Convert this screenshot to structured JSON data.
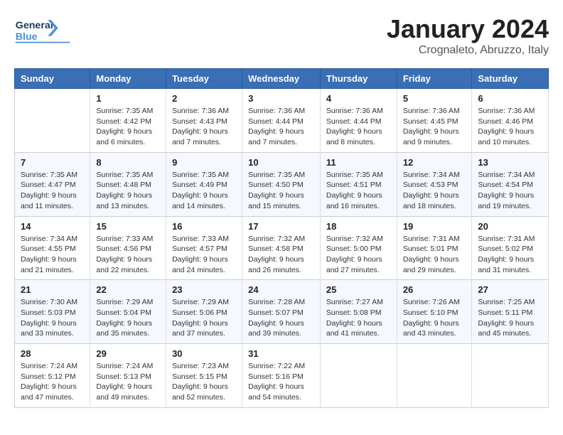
{
  "header": {
    "logo_line1": "General",
    "logo_line2": "Blue",
    "title": "January 2024",
    "subtitle": "Crognaleto, Abruzzo, Italy"
  },
  "columns": [
    "Sunday",
    "Monday",
    "Tuesday",
    "Wednesday",
    "Thursday",
    "Friday",
    "Saturday"
  ],
  "weeks": [
    [
      {
        "day": "",
        "info": ""
      },
      {
        "day": "1",
        "info": "Sunrise: 7:35 AM\nSunset: 4:42 PM\nDaylight: 9 hours\nand 6 minutes."
      },
      {
        "day": "2",
        "info": "Sunrise: 7:36 AM\nSunset: 4:43 PM\nDaylight: 9 hours\nand 7 minutes."
      },
      {
        "day": "3",
        "info": "Sunrise: 7:36 AM\nSunset: 4:44 PM\nDaylight: 9 hours\nand 7 minutes."
      },
      {
        "day": "4",
        "info": "Sunrise: 7:36 AM\nSunset: 4:44 PM\nDaylight: 9 hours\nand 8 minutes."
      },
      {
        "day": "5",
        "info": "Sunrise: 7:36 AM\nSunset: 4:45 PM\nDaylight: 9 hours\nand 9 minutes."
      },
      {
        "day": "6",
        "info": "Sunrise: 7:36 AM\nSunset: 4:46 PM\nDaylight: 9 hours\nand 10 minutes."
      }
    ],
    [
      {
        "day": "7",
        "info": "Sunrise: 7:35 AM\nSunset: 4:47 PM\nDaylight: 9 hours\nand 11 minutes."
      },
      {
        "day": "8",
        "info": "Sunrise: 7:35 AM\nSunset: 4:48 PM\nDaylight: 9 hours\nand 13 minutes."
      },
      {
        "day": "9",
        "info": "Sunrise: 7:35 AM\nSunset: 4:49 PM\nDaylight: 9 hours\nand 14 minutes."
      },
      {
        "day": "10",
        "info": "Sunrise: 7:35 AM\nSunset: 4:50 PM\nDaylight: 9 hours\nand 15 minutes."
      },
      {
        "day": "11",
        "info": "Sunrise: 7:35 AM\nSunset: 4:51 PM\nDaylight: 9 hours\nand 16 minutes."
      },
      {
        "day": "12",
        "info": "Sunrise: 7:34 AM\nSunset: 4:53 PM\nDaylight: 9 hours\nand 18 minutes."
      },
      {
        "day": "13",
        "info": "Sunrise: 7:34 AM\nSunset: 4:54 PM\nDaylight: 9 hours\nand 19 minutes."
      }
    ],
    [
      {
        "day": "14",
        "info": "Sunrise: 7:34 AM\nSunset: 4:55 PM\nDaylight: 9 hours\nand 21 minutes."
      },
      {
        "day": "15",
        "info": "Sunrise: 7:33 AM\nSunset: 4:56 PM\nDaylight: 9 hours\nand 22 minutes."
      },
      {
        "day": "16",
        "info": "Sunrise: 7:33 AM\nSunset: 4:57 PM\nDaylight: 9 hours\nand 24 minutes."
      },
      {
        "day": "17",
        "info": "Sunrise: 7:32 AM\nSunset: 4:58 PM\nDaylight: 9 hours\nand 26 minutes."
      },
      {
        "day": "18",
        "info": "Sunrise: 7:32 AM\nSunset: 5:00 PM\nDaylight: 9 hours\nand 27 minutes."
      },
      {
        "day": "19",
        "info": "Sunrise: 7:31 AM\nSunset: 5:01 PM\nDaylight: 9 hours\nand 29 minutes."
      },
      {
        "day": "20",
        "info": "Sunrise: 7:31 AM\nSunset: 5:02 PM\nDaylight: 9 hours\nand 31 minutes."
      }
    ],
    [
      {
        "day": "21",
        "info": "Sunrise: 7:30 AM\nSunset: 5:03 PM\nDaylight: 9 hours\nand 33 minutes."
      },
      {
        "day": "22",
        "info": "Sunrise: 7:29 AM\nSunset: 5:04 PM\nDaylight: 9 hours\nand 35 minutes."
      },
      {
        "day": "23",
        "info": "Sunrise: 7:29 AM\nSunset: 5:06 PM\nDaylight: 9 hours\nand 37 minutes."
      },
      {
        "day": "24",
        "info": "Sunrise: 7:28 AM\nSunset: 5:07 PM\nDaylight: 9 hours\nand 39 minutes."
      },
      {
        "day": "25",
        "info": "Sunrise: 7:27 AM\nSunset: 5:08 PM\nDaylight: 9 hours\nand 41 minutes."
      },
      {
        "day": "26",
        "info": "Sunrise: 7:26 AM\nSunset: 5:10 PM\nDaylight: 9 hours\nand 43 minutes."
      },
      {
        "day": "27",
        "info": "Sunrise: 7:25 AM\nSunset: 5:11 PM\nDaylight: 9 hours\nand 45 minutes."
      }
    ],
    [
      {
        "day": "28",
        "info": "Sunrise: 7:24 AM\nSunset: 5:12 PM\nDaylight: 9 hours\nand 47 minutes."
      },
      {
        "day": "29",
        "info": "Sunrise: 7:24 AM\nSunset: 5:13 PM\nDaylight: 9 hours\nand 49 minutes."
      },
      {
        "day": "30",
        "info": "Sunrise: 7:23 AM\nSunset: 5:15 PM\nDaylight: 9 hours\nand 52 minutes."
      },
      {
        "day": "31",
        "info": "Sunrise: 7:22 AM\nSunset: 5:16 PM\nDaylight: 9 hours\nand 54 minutes."
      },
      {
        "day": "",
        "info": ""
      },
      {
        "day": "",
        "info": ""
      },
      {
        "day": "",
        "info": ""
      }
    ]
  ]
}
